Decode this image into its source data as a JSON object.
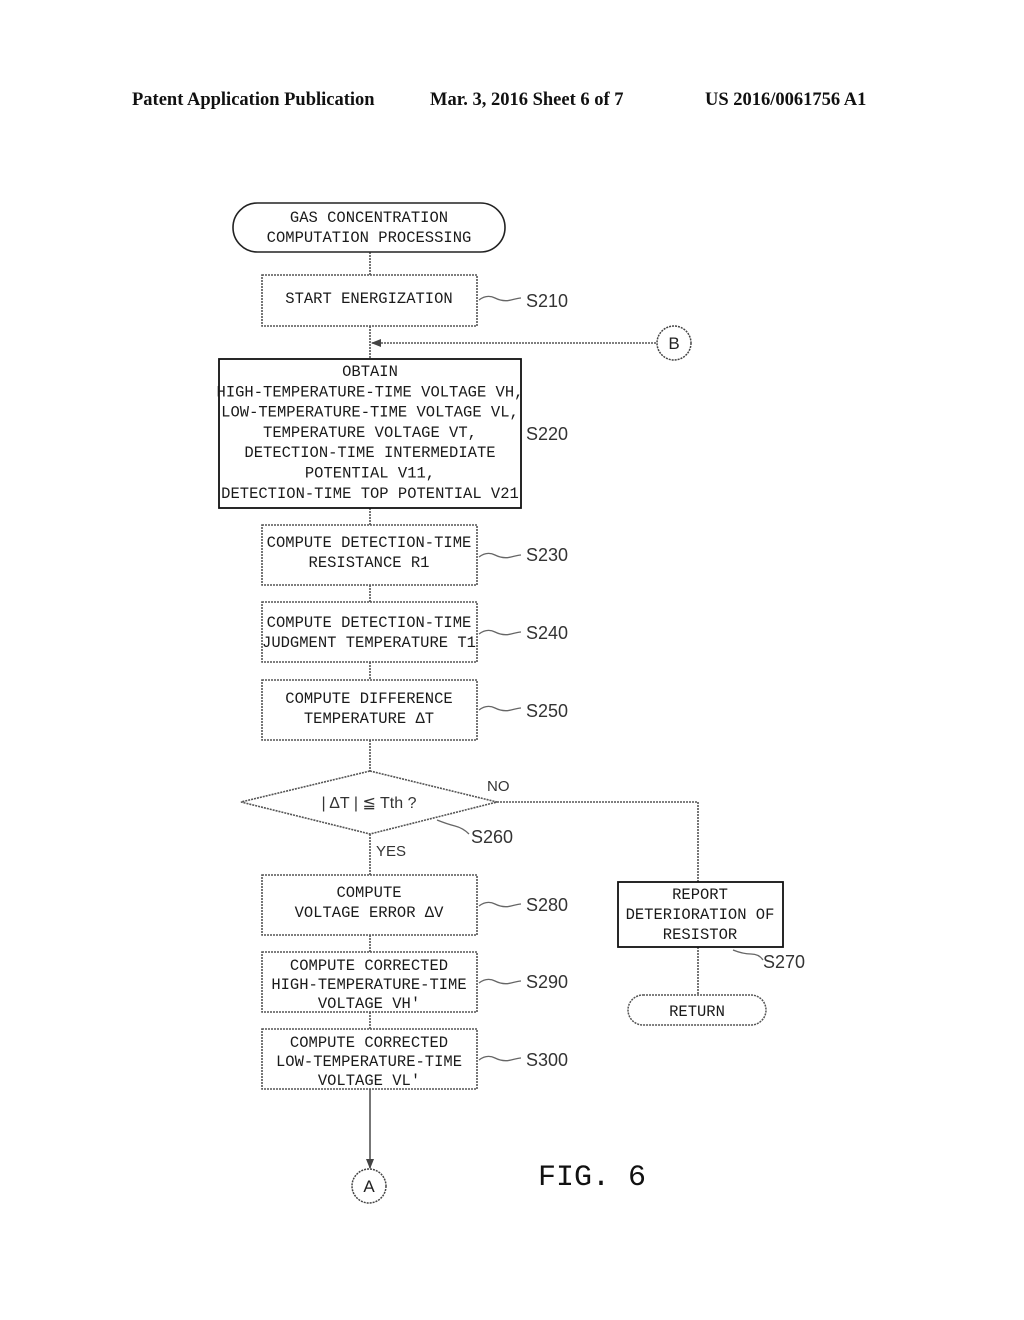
{
  "header": {
    "publication": "Patent Application Publication",
    "date_sheet": "Mar. 3, 2016   Sheet 6 of 7",
    "patent_number": "US 2016/0061756 A1"
  },
  "flowchart": {
    "start": {
      "lines": [
        "GAS CONCENTRATION",
        "COMPUTATION PROCESSING"
      ]
    },
    "steps": {
      "s210": {
        "label": "S210",
        "lines": [
          "START ENERGIZATION"
        ]
      },
      "s220": {
        "label": "S220",
        "lines": [
          "OBTAIN",
          "HIGH-TEMPERATURE-TIME VOLTAGE VH,",
          "LOW-TEMPERATURE-TIME VOLTAGE VL,",
          "TEMPERATURE VOLTAGE VT,",
          "DETECTION-TIME INTERMEDIATE",
          "POTENTIAL V11,",
          "DETECTION-TIME TOP POTENTIAL V21"
        ]
      },
      "s230": {
        "label": "S230",
        "lines": [
          "COMPUTE DETECTION-TIME",
          "RESISTANCE R1"
        ]
      },
      "s240": {
        "label": "S240",
        "lines": [
          "COMPUTE DETECTION-TIME",
          "JUDGMENT TEMPERATURE T1"
        ]
      },
      "s250": {
        "label": "S250",
        "lines": [
          "COMPUTE DIFFERENCE",
          "TEMPERATURE ΔT"
        ]
      },
      "s260": {
        "label": "S260",
        "lines": [
          "| ΔT |  ≦ Tth ?"
        ],
        "yes": "YES",
        "no": "NO"
      },
      "s270": {
        "label": "S270",
        "lines": [
          "REPORT",
          "DETERIORATION OF",
          "RESISTOR"
        ]
      },
      "s280": {
        "label": "S280",
        "lines": [
          "COMPUTE",
          "VOLTAGE ERROR ΔV"
        ]
      },
      "s290": {
        "label": "S290",
        "lines": [
          "COMPUTE CORRECTED",
          "HIGH-TEMPERATURE-TIME",
          "VOLTAGE VH'"
        ]
      },
      "s300": {
        "label": "S300",
        "lines": [
          "COMPUTE CORRECTED",
          "LOW-TEMPERATURE-TIME",
          "VOLTAGE VL'"
        ]
      }
    },
    "return": {
      "lines": [
        "RETURN"
      ]
    },
    "connectors": {
      "a": "A",
      "b": "B"
    }
  },
  "figure_label": "FIG. 6"
}
